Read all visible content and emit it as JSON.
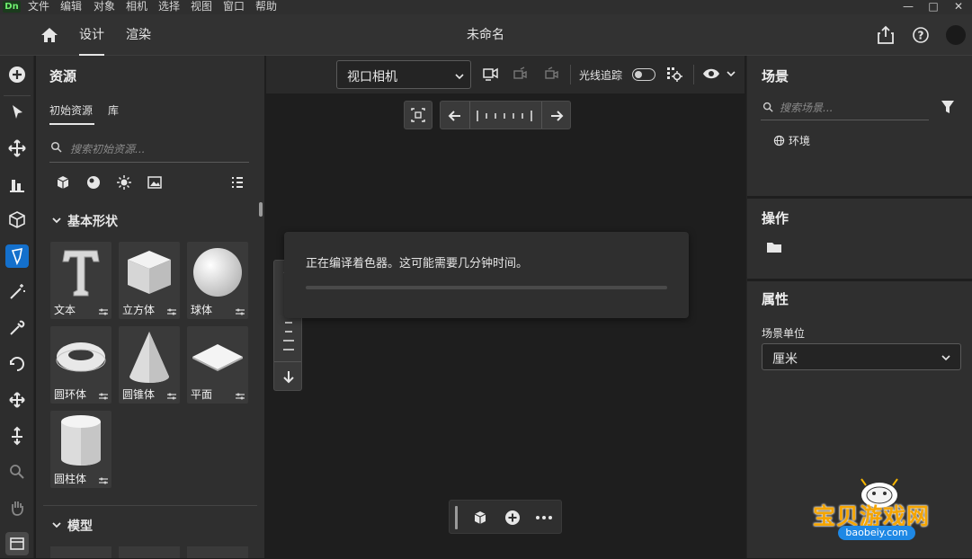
{
  "app": {
    "logo": "Dn",
    "document_title": "未命名"
  },
  "menu": [
    "文件",
    "编辑",
    "对象",
    "相机",
    "选择",
    "视图",
    "窗口",
    "帮助"
  ],
  "window_controls": {
    "minimize": "—",
    "maximize": "□",
    "close": "✕"
  },
  "header": {
    "tabs": [
      {
        "label": "设计",
        "active": true
      },
      {
        "label": "渲染",
        "active": false
      }
    ]
  },
  "assets": {
    "title": "资源",
    "subtabs": [
      {
        "label": "初始资源",
        "active": true
      },
      {
        "label": "库",
        "active": false
      }
    ],
    "search_placeholder": "搜索初始资源...",
    "section_basic": "基本形状",
    "section_models": "模型",
    "shapes": [
      {
        "label": "文本",
        "icon": "text-3d-icon"
      },
      {
        "label": "立方体",
        "icon": "cube-icon"
      },
      {
        "label": "球体",
        "icon": "sphere-icon"
      },
      {
        "label": "圆环体",
        "icon": "torus-icon"
      },
      {
        "label": "圆锥体",
        "icon": "cone-icon"
      },
      {
        "label": "平面",
        "icon": "plane-icon"
      },
      {
        "label": "圆柱体",
        "icon": "cylinder-icon"
      }
    ]
  },
  "viewport": {
    "camera_select": "视口相机",
    "raytrace_label": "光线追踪",
    "raytrace_on": false,
    "toast_message": "正在编译着色器。这可能需要几分钟时间。"
  },
  "scene": {
    "title": "场景",
    "search_placeholder": "搜索场景...",
    "items": [
      {
        "label": "环境",
        "icon": "globe-icon"
      }
    ]
  },
  "actions": {
    "title": "操作"
  },
  "properties": {
    "title": "属性",
    "scene_unit_label": "场景单位",
    "scene_unit_value": "厘米"
  },
  "watermark": {
    "text": "宝贝游戏网",
    "url": "baobeiy.com"
  },
  "colors": {
    "accent": "#1470cc",
    "panel": "#2f2f2f",
    "viewport": "#1e1e1e"
  }
}
